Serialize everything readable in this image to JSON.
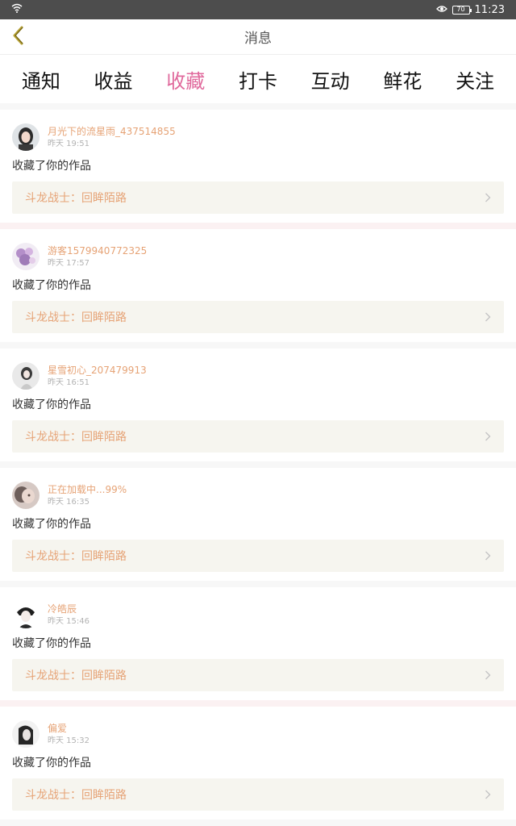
{
  "status": {
    "time": "11:23",
    "battery": "70"
  },
  "header": {
    "title": "消息"
  },
  "tabs": [
    {
      "label": "通知",
      "active": false
    },
    {
      "label": "收益",
      "active": false
    },
    {
      "label": "收藏",
      "active": true
    },
    {
      "label": "打卡",
      "active": false
    },
    {
      "label": "互动",
      "active": false
    },
    {
      "label": "鲜花",
      "active": false
    },
    {
      "label": "关注",
      "active": false
    }
  ],
  "colors": {
    "accent": "#e0699c",
    "username": "#e6a376",
    "work_bg": "#f6f5ef"
  },
  "items": [
    {
      "user": "月光下的流星雨_437514855",
      "time": "昨天 19:51",
      "action": "收藏了你的作品",
      "work": "斗龙战士：回眸陌路"
    },
    {
      "user": "游客1579940772325",
      "time": "昨天 17:57",
      "action": "收藏了你的作品",
      "work": "斗龙战士：回眸陌路"
    },
    {
      "user": "星雪初心_207479913",
      "time": "昨天 16:51",
      "action": "收藏了你的作品",
      "work": "斗龙战士：回眸陌路"
    },
    {
      "user": "正在加载中...99%",
      "time": "昨天 16:35",
      "action": "收藏了你的作品",
      "work": "斗龙战士：回眸陌路"
    },
    {
      "user": "冷皓辰",
      "time": "昨天 15:46",
      "action": "收藏了你的作品",
      "work": "斗龙战士：回眸陌路"
    },
    {
      "user": "偏爱",
      "time": "昨天 15:32",
      "action": "收藏了你的作品",
      "work": "斗龙战士：回眸陌路"
    }
  ]
}
